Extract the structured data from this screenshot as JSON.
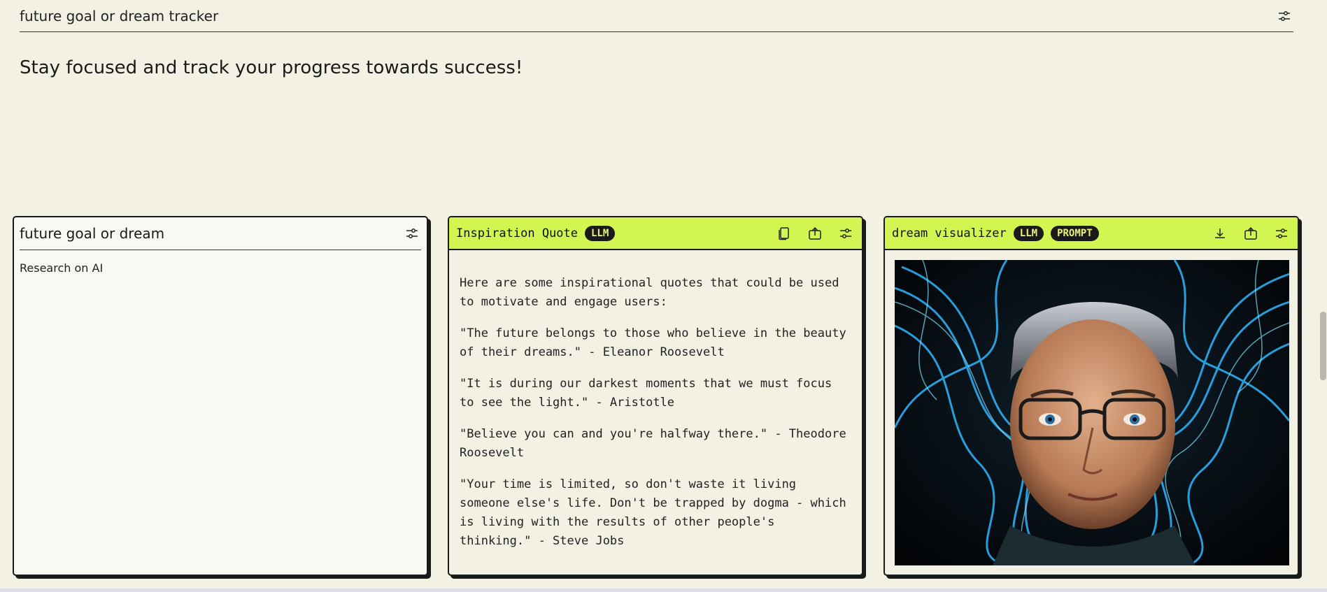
{
  "header": {
    "title": "future goal or dream tracker"
  },
  "subtitle": "Stay focused and track your progress towards success!",
  "card_goal": {
    "title": "future goal or dream",
    "value": "Research on AI"
  },
  "card_quote": {
    "title": "Inspiration Quote",
    "badge": "LLM",
    "paragraphs": [
      "Here are some inspirational quotes that could be used to motivate and engage users:",
      "\"The future belongs to those who believe in the beauty of their dreams.\" - Eleanor Roosevelt",
      "\"It is during our darkest moments that we must focus to see the light.\" - Aristotle",
      "\"Believe you can and you're halfway there.\" - Theodore Roosevelt",
      "\"Your time is limited, so don't waste it living someone else's life. Don't be trapped by dogma - which is living with the results of other people's thinking.\" - Steve Jobs"
    ]
  },
  "card_visualizer": {
    "title": "dream visualizer",
    "badges": [
      "LLM",
      "PROMPT"
    ]
  },
  "colors": {
    "background": "#f3f1e4",
    "accent": "#d2f552",
    "ink": "#1a1a1a"
  },
  "icons": [
    "sliders-icon",
    "copy-icon",
    "share-icon",
    "download-icon"
  ]
}
